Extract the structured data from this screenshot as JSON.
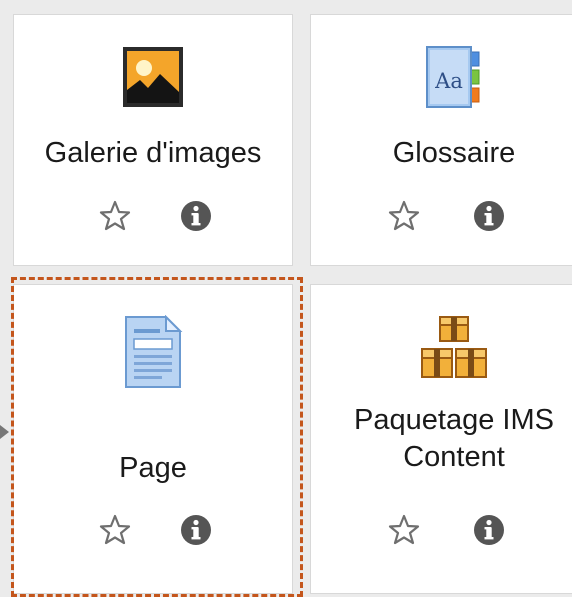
{
  "activities": [
    {
      "label_lines": [
        "Galerie d'images"
      ],
      "icon": "image-gallery-icon"
    },
    {
      "label_lines": [
        "Glossaire"
      ],
      "icon": "glossary-icon"
    },
    {
      "label_lines": [
        "Page"
      ],
      "icon": "page-icon"
    },
    {
      "label_lines": [
        "Paquetage IMS",
        "Content"
      ],
      "icon": "ims-package-icon"
    }
  ],
  "actions": {
    "star_icon": "star-outline-icon",
    "info_icon": "info-circle-icon"
  },
  "colors": {
    "highlight": "#c4561c",
    "info_icon": "#555555",
    "star_icon": "#6f6f6f"
  }
}
